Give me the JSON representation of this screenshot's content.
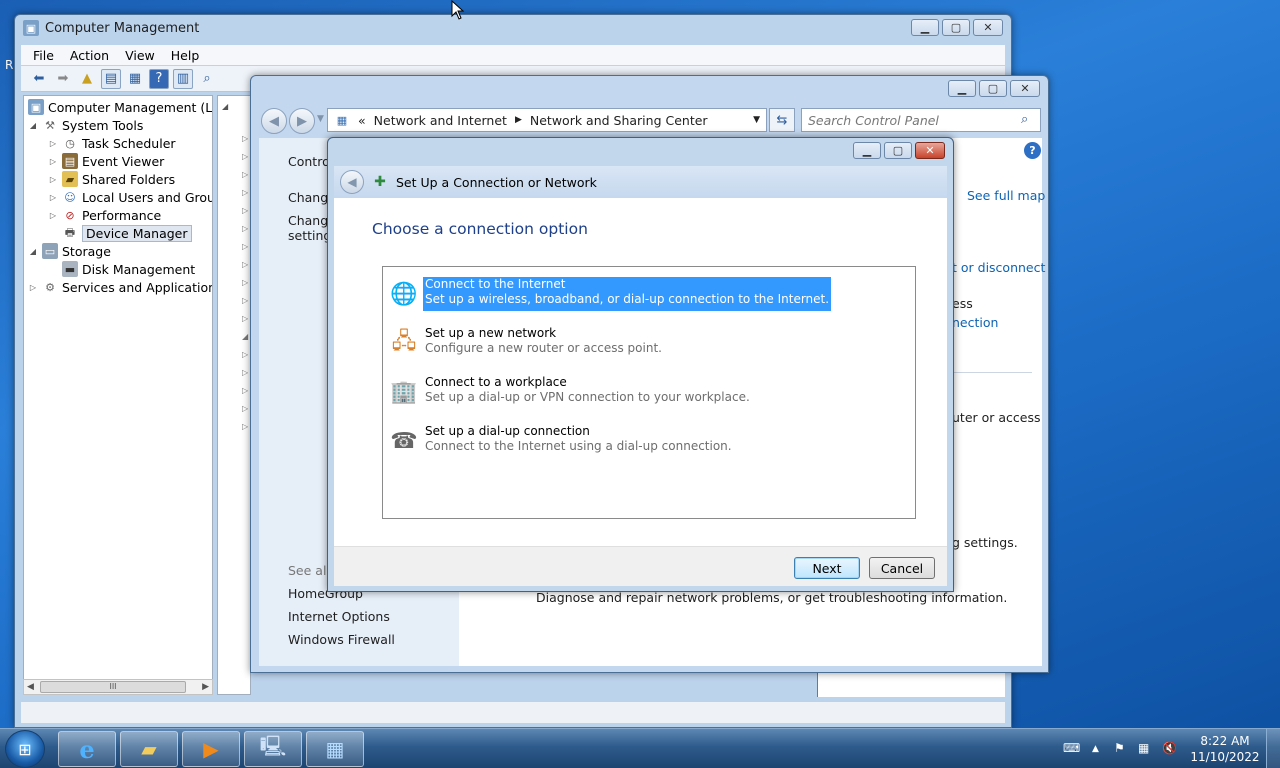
{
  "desktop": {
    "edge_letter": "R"
  },
  "computer_management": {
    "title": "Computer Management",
    "menu": [
      "File",
      "Action",
      "View",
      "Help"
    ],
    "tree": [
      {
        "label": "Computer Management (Local",
        "icon": "computer-management-icon"
      },
      {
        "label": "System Tools",
        "icon": "tools-icon"
      },
      {
        "label": "Task Scheduler",
        "icon": "clock-icon"
      },
      {
        "label": "Event Viewer",
        "icon": "event-viewer-icon"
      },
      {
        "label": "Shared Folders",
        "icon": "shared-folder-icon"
      },
      {
        "label": "Local Users and Groups",
        "icon": "users-icon"
      },
      {
        "label": "Performance",
        "icon": "performance-icon"
      },
      {
        "label": "Device Manager",
        "icon": "device-manager-icon",
        "selected": true
      },
      {
        "label": "Storage",
        "icon": "storage-icon"
      },
      {
        "label": "Disk Management",
        "icon": "disk-icon"
      },
      {
        "label": "Services and Applications",
        "icon": "services-icon"
      }
    ],
    "scroll_grip": "III"
  },
  "network_center": {
    "breadcrumb_lead": "«",
    "breadcrumb": [
      "Network and Internet",
      "Network and Sharing Center"
    ],
    "search_placeholder": "Search Control Panel",
    "left_links": {
      "control": "Control",
      "change1": "Change",
      "change2": "Change",
      "settings": "settings"
    },
    "see_also": "See also",
    "see_also_links": [
      "HomeGroup",
      "Internet Options",
      "Windows Firewall"
    ],
    "see_full_map": "See full map",
    "right_fragments": {
      "connect": "t or disconnect",
      "ess": "ess",
      "nection": "nection",
      "router": "uter or access",
      "settings": "g settings.",
      "diagnose": "Diagnose and repair network problems, or get troubleshooting information."
    }
  },
  "dialog": {
    "title": "Set Up a Connection or Network",
    "heading": "Choose a connection option",
    "options": [
      {
        "title": "Connect to the Internet",
        "desc": "Set up a wireless, broadband, or dial-up connection to the Internet.",
        "icon": "globe-icon",
        "selected": true
      },
      {
        "title": "Set up a new network",
        "desc": "Configure a new router or access point.",
        "icon": "new-network-icon"
      },
      {
        "title": "Connect to a workplace",
        "desc": "Set up a dial-up or VPN connection to your workplace.",
        "icon": "workplace-icon"
      },
      {
        "title": "Set up a dial-up connection",
        "desc": "Connect to the Internet using a dial-up connection.",
        "icon": "phone-icon"
      }
    ],
    "next": "Next",
    "cancel": "Cancel"
  },
  "taskbar": {
    "items": [
      "internet-explorer-icon",
      "file-explorer-icon",
      "media-player-icon",
      "computer-management-icon",
      "network-center-icon"
    ],
    "time": "8:22 AM",
    "date": "11/10/2022"
  }
}
